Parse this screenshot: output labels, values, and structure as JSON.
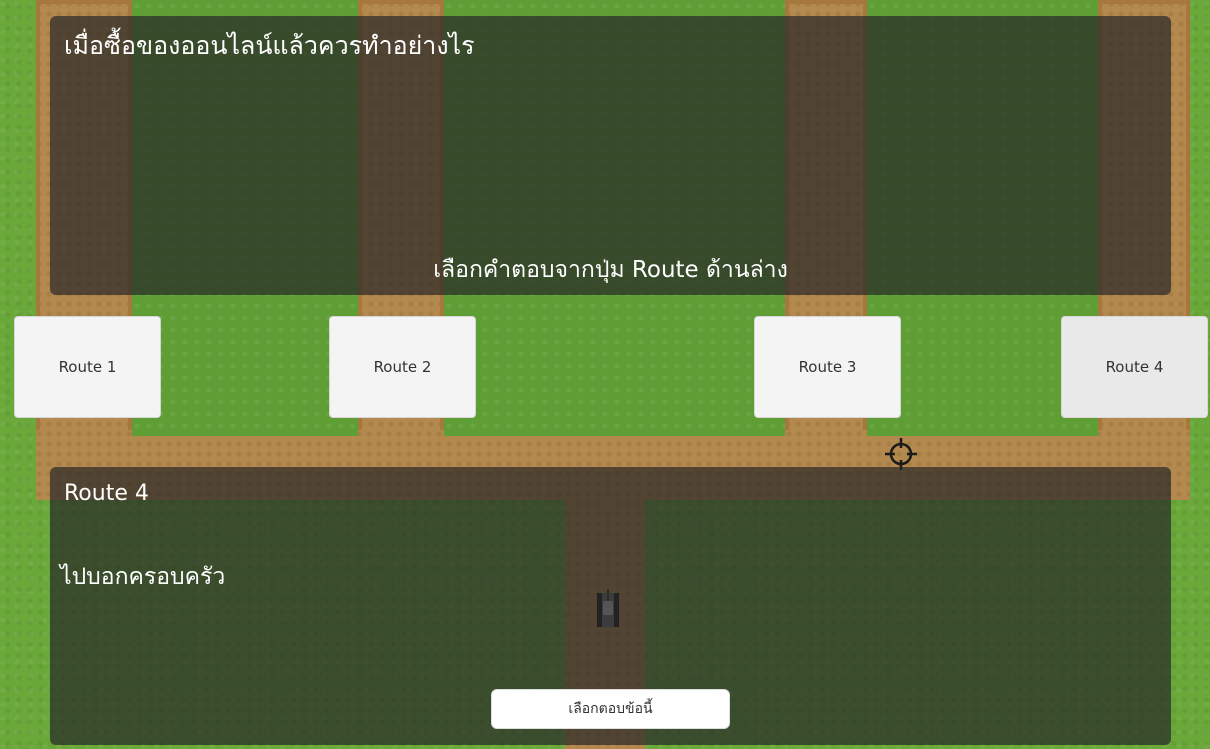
{
  "question": {
    "text": "เมื่อซื้อของออนไลน์แล้วควรทำอย่างไร",
    "instruction": "เลือกคำตอบจากปุ่ม Route ด้านล่าง"
  },
  "routes": [
    {
      "label": "Route 1",
      "selected": false
    },
    {
      "label": "Route 2",
      "selected": false
    },
    {
      "label": "Route 3",
      "selected": false
    },
    {
      "label": "Route 4",
      "selected": true
    }
  ],
  "answer": {
    "route_title": "Route 4",
    "text": "ไปบอกครอบครัว",
    "select_button": "เลือกตอบข้อนี้"
  },
  "icons": {
    "crosshair": "crosshair-icon",
    "player": "tank-sprite"
  },
  "colors": {
    "grass": "#6aa83a",
    "dirt": "#b4894e",
    "panel": "#262626"
  }
}
